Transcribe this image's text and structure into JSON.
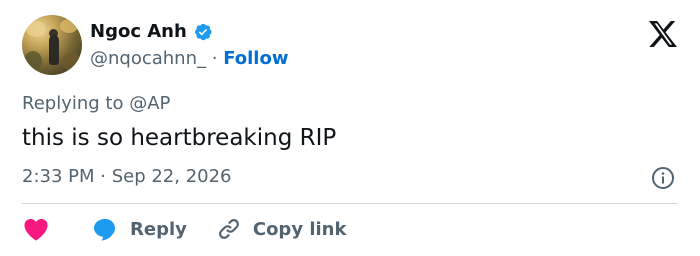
{
  "author": {
    "name": "Ngoc Anh",
    "handle": "@nqocahnn_",
    "separator": "·",
    "follow_label": "Follow"
  },
  "replying_to": "Replying to @AP",
  "text": "this is so heartbreaking RIP",
  "timestamp": "2:33 PM · Sep 22, 2026",
  "actions": {
    "reply_label": "Reply",
    "copy_link_label": "Copy link"
  },
  "icons": {
    "verified": "verified-badge-icon",
    "logo": "x-logo-icon",
    "info": "info-icon",
    "like": "heart-icon",
    "reply": "speech-bubble-icon",
    "link": "link-icon"
  },
  "colors": {
    "verified": "#1d9bf0",
    "follow": "#006fd6",
    "heart": "#f91880",
    "reply_bubble": "#1d9bf0",
    "secondary_text": "#536471"
  }
}
